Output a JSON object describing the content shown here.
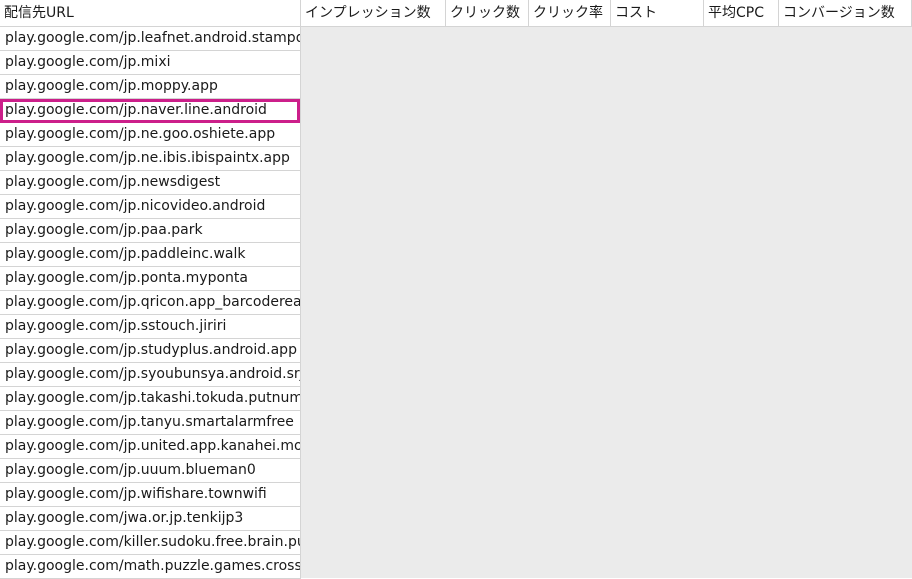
{
  "columns": [
    {
      "label": "配信先URL"
    },
    {
      "label": "インプレッション数"
    },
    {
      "label": "クリック数"
    },
    {
      "label": "クリック率"
    },
    {
      "label": "コスト"
    },
    {
      "label": "平均CPC"
    },
    {
      "label": "コンバージョン数"
    }
  ],
  "highlight_color": "#cc1f8a",
  "grey_fill": "#ebebeb",
  "rows": [
    {
      "url": "play.google.com/jp.leafnet.android.stampd",
      "highlighted": false
    },
    {
      "url": "play.google.com/jp.mixi",
      "highlighted": false
    },
    {
      "url": "play.google.com/jp.moppy.app",
      "highlighted": false
    },
    {
      "url": "play.google.com/jp.naver.line.android",
      "highlighted": true
    },
    {
      "url": "play.google.com/jp.ne.goo.oshiete.app",
      "highlighted": false
    },
    {
      "url": "play.google.com/jp.ne.ibis.ibispaintx.app",
      "highlighted": false
    },
    {
      "url": "play.google.com/jp.newsdigest",
      "highlighted": false
    },
    {
      "url": "play.google.com/jp.nicovideo.android",
      "highlighted": false
    },
    {
      "url": "play.google.com/jp.paa.park",
      "highlighted": false
    },
    {
      "url": "play.google.com/jp.paddleinc.walk",
      "highlighted": false
    },
    {
      "url": "play.google.com/jp.ponta.myponta",
      "highlighted": false
    },
    {
      "url": "play.google.com/jp.qricon.app_barcoderead",
      "highlighted": false
    },
    {
      "url": "play.google.com/jp.sstouch.jiriri",
      "highlighted": false
    },
    {
      "url": "play.google.com/jp.studyplus.android.app",
      "highlighted": false
    },
    {
      "url": "play.google.com/jp.syoubunsya.android.srj",
      "highlighted": false
    },
    {
      "url": "play.google.com/jp.takashi.tokuda.putnum",
      "highlighted": false
    },
    {
      "url": "play.google.com/jp.tanyu.smartalarmfree",
      "highlighted": false
    },
    {
      "url": "play.google.com/jp.united.app.kanahei.mon",
      "highlighted": false
    },
    {
      "url": "play.google.com/jp.uuum.blueman0",
      "highlighted": false
    },
    {
      "url": "play.google.com/jp.wifishare.townwifi",
      "highlighted": false
    },
    {
      "url": "play.google.com/jwa.or.jp.tenkijp3",
      "highlighted": false
    },
    {
      "url": "play.google.com/killer.sudoku.free.brain.pu",
      "highlighted": false
    },
    {
      "url": "play.google.com/math.puzzle.games.crossn",
      "highlighted": false
    }
  ]
}
